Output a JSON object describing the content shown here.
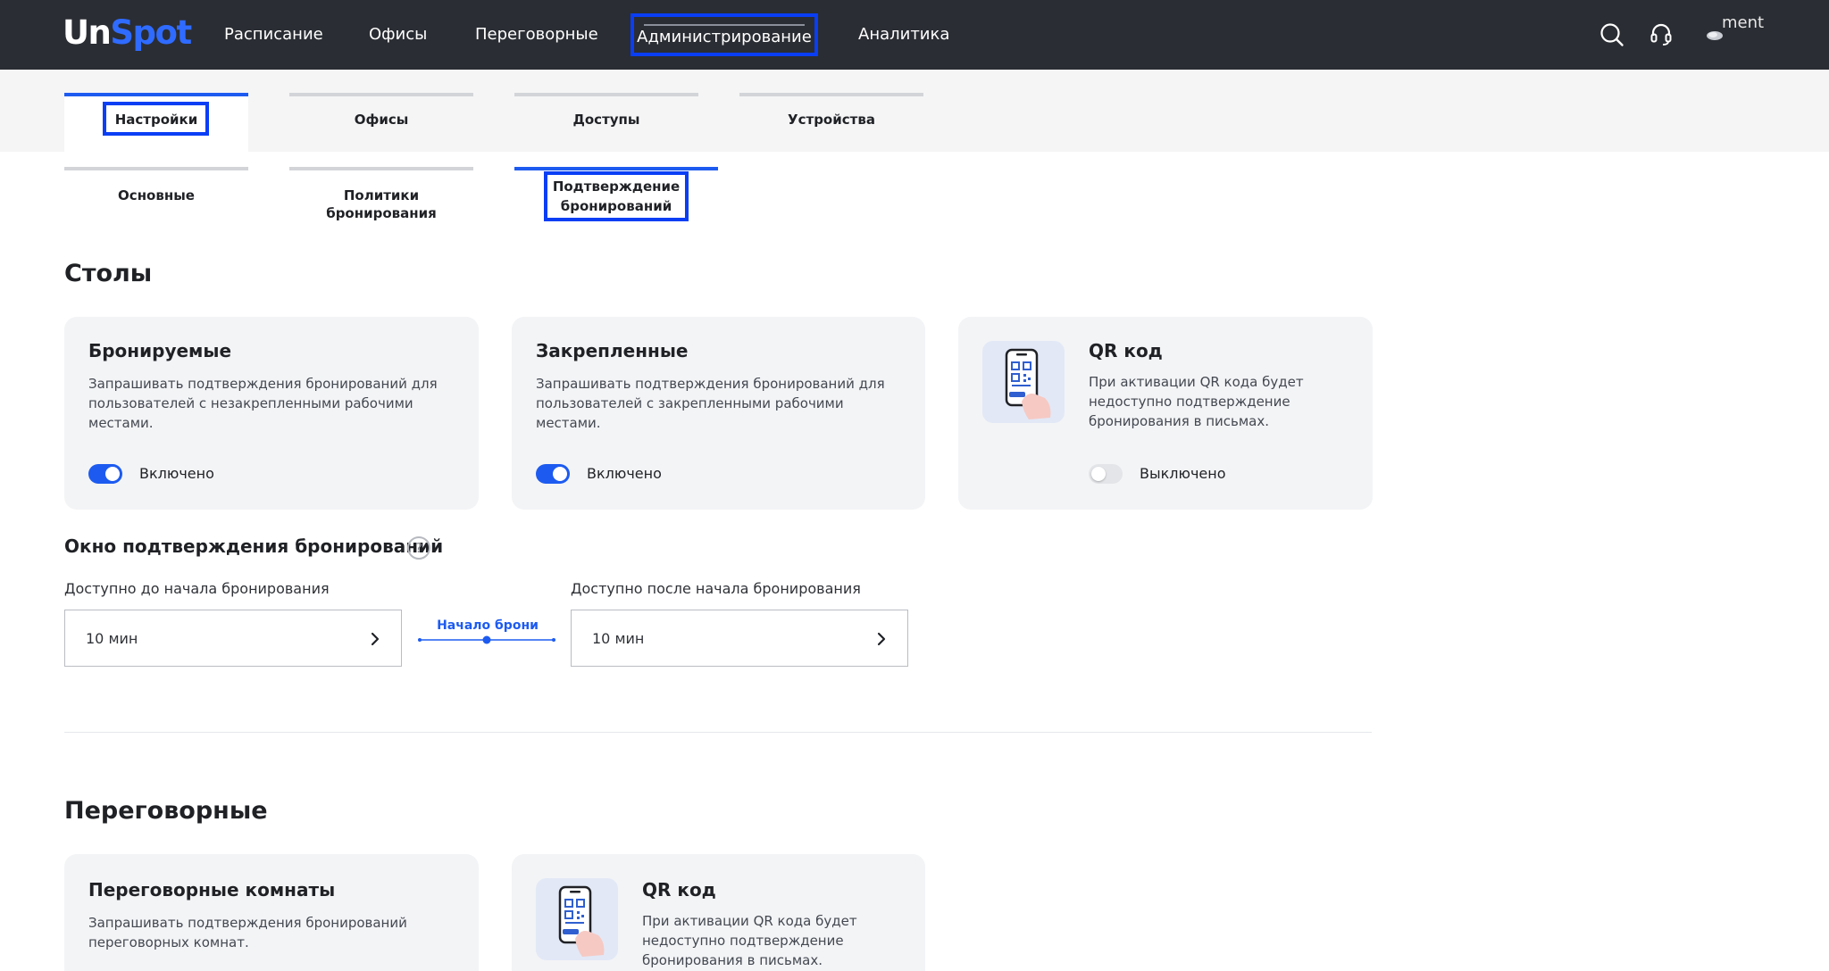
{
  "header": {
    "logo_part1": "Un",
    "logo_part2": "Spot",
    "nav": [
      "Расписание",
      "Офисы",
      "Переговорные",
      "Администрирование",
      "Аналитика"
    ],
    "active_nav": "Администрирование",
    "avatar_text": "ment"
  },
  "tabs": {
    "primary": [
      "Настройки",
      "Офисы",
      "Доступы",
      "Устройства"
    ],
    "active_primary": "Настройки",
    "secondary": [
      "Основные",
      "Политики бронирования",
      "Подтверждение\nбронирований"
    ],
    "active_secondary": "Подтверждение бронирований"
  },
  "desks": {
    "title": "Столы",
    "cards": [
      {
        "title": "Бронируемые",
        "description": "Запрашивать подтверждения бронирований для пользователей с незакрепленными рабочими местами.",
        "toggle_state": "on",
        "toggle_label": "Включено"
      },
      {
        "title": "Закрепленные",
        "description": "Запрашивать подтверждения бронирований для пользователей с закрепленными рабочими местами.",
        "toggle_state": "on",
        "toggle_label": "Включено"
      },
      {
        "title": "QR код",
        "description": "При активации QR кода будет недоступно подтверждение бронирования в письмах.",
        "toggle_state": "off",
        "toggle_label": "Выключено",
        "icon": "phone-qr-icon"
      }
    ],
    "window": {
      "title": "Окно подтверждения бронирований",
      "help_icon": "?",
      "before_label": "Доступно до начала бронирования",
      "before_value": "10 мин",
      "timeline_label": "Начало брони",
      "after_label": "Доступно после начала бронирования",
      "after_value": "10 мин"
    }
  },
  "rooms": {
    "title": "Переговорные",
    "cards": [
      {
        "title": "Переговорные комнаты",
        "description": "Запрашивать подтверждения бронирований переговорных комнат."
      },
      {
        "title": "QR код",
        "description": "При активации QR кода будет недоступно подтверждение бронирования в письмах.",
        "icon": "phone-qr-icon"
      }
    ]
  },
  "colors": {
    "header_bg": "#2a2d33",
    "accent": "#1d5bf0",
    "highlight_box": "#0a3ef5",
    "card_bg": "#f3f4f6"
  }
}
